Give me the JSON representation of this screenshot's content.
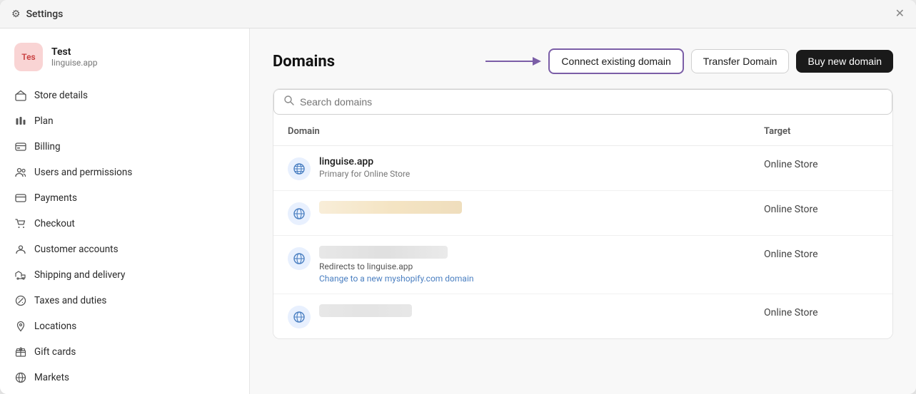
{
  "titlebar": {
    "icon": "⚙",
    "title": "Settings",
    "close_label": "✕"
  },
  "sidebar": {
    "profile": {
      "avatar_text": "Tes",
      "name": "Test",
      "domain": "linguise.app"
    },
    "nav_items": [
      {
        "id": "store-details",
        "icon": "🏠",
        "label": "Store details"
      },
      {
        "id": "plan",
        "icon": "📊",
        "label": "Plan"
      },
      {
        "id": "billing",
        "icon": "🪪",
        "label": "Billing"
      },
      {
        "id": "users-permissions",
        "icon": "👥",
        "label": "Users and permissions"
      },
      {
        "id": "payments",
        "icon": "💳",
        "label": "Payments"
      },
      {
        "id": "checkout",
        "icon": "🛒",
        "label": "Checkout"
      },
      {
        "id": "customer-accounts",
        "icon": "👤",
        "label": "Customer accounts"
      },
      {
        "id": "shipping-delivery",
        "icon": "🚗",
        "label": "Shipping and delivery"
      },
      {
        "id": "taxes-duties",
        "icon": "🏷",
        "label": "Taxes and duties"
      },
      {
        "id": "locations",
        "icon": "📍",
        "label": "Locations"
      },
      {
        "id": "gift-cards",
        "icon": "🎁",
        "label": "Gift cards"
      },
      {
        "id": "markets",
        "icon": "🌐",
        "label": "Markets"
      }
    ]
  },
  "content": {
    "page_title": "Domains",
    "buttons": {
      "connect": "Connect existing domain",
      "transfer": "Transfer Domain",
      "buy": "Buy new domain"
    },
    "search": {
      "placeholder": "Search domains"
    },
    "table": {
      "headers": {
        "domain": "Domain",
        "target": "Target"
      },
      "rows": [
        {
          "domain_name": "linguise.app",
          "sub": "Primary for Online Store",
          "target": "Online Store",
          "type": "named"
        },
        {
          "type": "blurred1",
          "target": "Online Store"
        },
        {
          "type": "blurred2",
          "redirect": "Redirects to linguise.app",
          "link": "Change to a new myshopify.com domain",
          "target": "Online Store"
        },
        {
          "type": "blurred3",
          "target": "Online Store"
        }
      ]
    }
  }
}
